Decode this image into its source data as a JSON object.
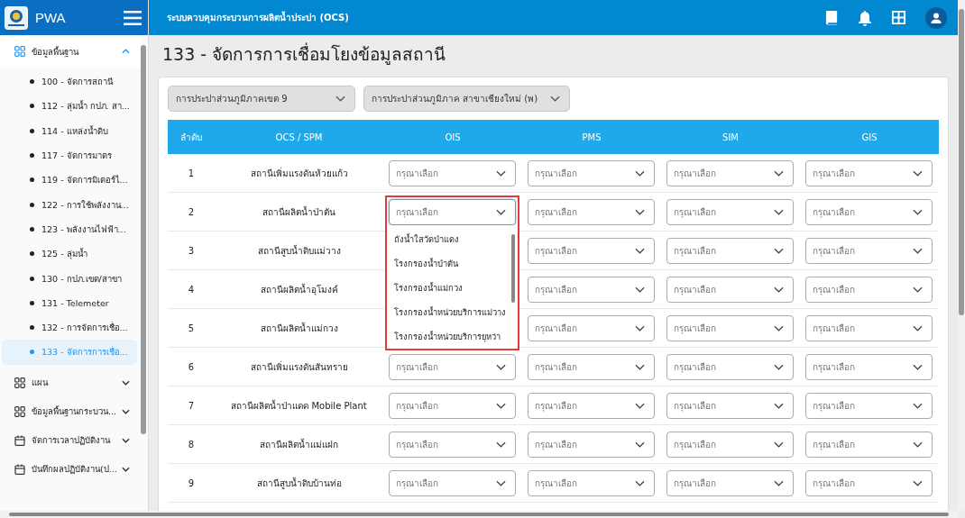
{
  "app": {
    "logo_text": "PWA",
    "system_title": "ระบบควบคุมกระบวนการผลิตน้ำประปา (OCS)"
  },
  "sidebar": {
    "groups": [
      {
        "label": "ข้อมูลพื้นฐาน",
        "kind": "grid",
        "expanded": true,
        "children": [
          {
            "label": "100 - จัดการสถานี",
            "selected": false
          },
          {
            "label": "112 - ลุ่มน้ำ กปภ. สา...",
            "selected": false
          },
          {
            "label": "114 - แหล่งน้ำดิบ",
            "selected": false
          },
          {
            "label": "117 - จัดการมาตร",
            "selected": false
          },
          {
            "label": "119 - จัดการมิเตอร์ไ...",
            "selected": false
          },
          {
            "label": "122 - การใช้พลังงาน...",
            "selected": false
          },
          {
            "label": "123 - พลังงานไฟฟ้า...",
            "selected": false
          },
          {
            "label": "125 - ลุ่มน้ำ",
            "selected": false
          },
          {
            "label": "130 - กปภ.เขต/สาขา",
            "selected": false
          },
          {
            "label": "131 - Telemeter",
            "selected": false
          },
          {
            "label": "132 - การจัดการเชื่อ...",
            "selected": false
          },
          {
            "label": "133 - จัดการการเชื่อ...",
            "selected": true
          }
        ]
      },
      {
        "label": "แผน",
        "kind": "grid",
        "expanded": false
      },
      {
        "label": "ข้อมูลพื้นฐานกระบวน...",
        "kind": "grid",
        "expanded": false
      },
      {
        "label": "จัดการเวลาปฏิบัติงาน",
        "kind": "calendar",
        "expanded": false
      },
      {
        "label": "บันทึกผลปฏิบัติงาน(ป...",
        "kind": "calendar",
        "expanded": false
      }
    ]
  },
  "page_title": "133 - จัดการการเชื่อมโยงข้อมูลสถานี",
  "filters": [
    {
      "value": "การประปาส่วนภูมิภาคเขต 9"
    },
    {
      "value": "การประปาส่วนภูมิภาค สาขาเชียงใหม่ (พ)"
    }
  ],
  "table": {
    "columns": [
      "ลำดับ",
      "OCS / SPM",
      "OIS",
      "PMS",
      "SIM",
      "GIS"
    ],
    "rows": [
      {
        "index": "1",
        "station": "สถานีเพิ่มแรงดันห้วยแก้ว",
        "ois": {
          "placeholder": "กรุณาเลือก"
        },
        "pms": {
          "placeholder": "กรุณาเลือก"
        },
        "sim": {
          "placeholder": "กรุณาเลือก"
        },
        "gis": {
          "placeholder": "กรุณาเลือก"
        }
      },
      {
        "index": "2",
        "station": "สถานีผลิตน้ำป่าตัน",
        "ois": {
          "placeholder": "กรุณาเลือก",
          "focused": true,
          "highlighted": true,
          "options": [
            "ถังน้ำใสวัดป่าแดง",
            "โรงกรองน้ำป่าตัน",
            "โรงกรองน้ำแม่กวง",
            "โรงกรองน้ำหน่วยบริการแม่วาง",
            "โรงกรองน้ำหน่วยบริการยุหว่า"
          ]
        },
        "pms": {
          "placeholder": "กรุณาเลือก"
        },
        "sim": {
          "placeholder": "กรุณาเลือก"
        },
        "gis": {
          "placeholder": "กรุณาเลือก"
        }
      },
      {
        "index": "3",
        "station": "สถานีสูบน้ำดิบแม่วาง",
        "pms": {
          "placeholder": "กรุณาเลือก"
        },
        "sim": {
          "placeholder": "กรุณาเลือก"
        },
        "gis": {
          "placeholder": "กรุณาเลือก"
        }
      },
      {
        "index": "4",
        "station": "สถานีผลิตน้ำอุโมงค์",
        "pms": {
          "placeholder": "กรุณาเลือก"
        },
        "sim": {
          "placeholder": "กรุณาเลือก"
        },
        "gis": {
          "placeholder": "กรุณาเลือก"
        }
      },
      {
        "index": "5",
        "station": "สถานีผลิตน้ำแม่กวง",
        "pms": {
          "placeholder": "กรุณาเลือก"
        },
        "sim": {
          "placeholder": "กรุณาเลือก"
        },
        "gis": {
          "placeholder": "กรุณาเลือก"
        }
      },
      {
        "index": "6",
        "station": "สถานีเพิ่มแรงดันสันทราย",
        "ois": {
          "placeholder": "กรุณาเลือก"
        },
        "pms": {
          "placeholder": "กรุณาเลือก"
        },
        "sim": {
          "placeholder": "กรุณาเลือก"
        },
        "gis": {
          "placeholder": "กรุณาเลือก"
        }
      },
      {
        "index": "7",
        "station": "สถานีผลิตน้ำป่าแดด Mobile Plant",
        "ois": {
          "placeholder": "กรุณาเลือก"
        },
        "pms": {
          "placeholder": "กรุณาเลือก"
        },
        "sim": {
          "placeholder": "กรุณาเลือก"
        },
        "gis": {
          "placeholder": "กรุณาเลือก"
        }
      },
      {
        "index": "8",
        "station": "สถานีผลิตน้ำแม่แฝก",
        "ois": {
          "placeholder": "กรุณาเลือก"
        },
        "pms": {
          "placeholder": "กรุณาเลือก"
        },
        "sim": {
          "placeholder": "กรุณาเลือก"
        },
        "gis": {
          "placeholder": "กรุณาเลือก"
        }
      },
      {
        "index": "9",
        "station": "สถานีสูบน้ำดิบบ้านท่อ",
        "ois": {
          "placeholder": "กรุณาเลือก"
        },
        "pms": {
          "placeholder": "กรุณาเลือก"
        },
        "sim": {
          "placeholder": "กรุณาเลือก"
        },
        "gis": {
          "placeholder": "กรุณาเลือก"
        }
      }
    ]
  }
}
